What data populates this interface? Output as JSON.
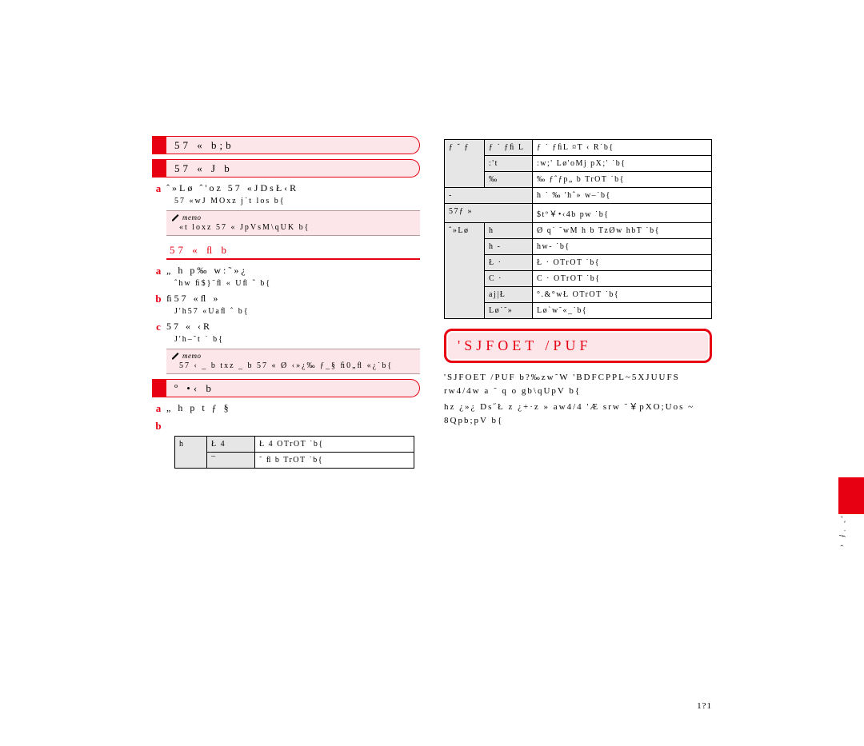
{
  "left": {
    "tab1": "57 «  b;b",
    "tab2": "57 « J b",
    "step_a": {
      "num": "a",
      "txt": "ˆ»Lø ˆ'oz 57 «JDsŁ‹R",
      "desc": "57 «wJ MOxz j˙t los b{"
    },
    "memo1": {
      "label": "memo",
      "body": "«t loxz 57 « JpVsM\\qUK b{"
    },
    "sub1": "57 « ﬂ b",
    "step_b": {
      "num": "a",
      "txt": "„ h p‰  w:˜»¿",
      "desc": "ˆhw ﬁ$}˜ﬂ  « Uﬂ ˆ b{"
    },
    "step_c": {
      "num": "b",
      "txt": "ﬁ57 «ﬂ »",
      "desc": "J'h57 «Uaﬂ ˆ b{"
    },
    "step_d": {
      "num": "c",
      "txt": "57 « ‹R",
      "desc": "J'h–˜t ˙ b{"
    },
    "memo2": {
      "label": "memo",
      "body": "57 ‹ _ b txz _ b 57 « Ø ‹»¿‰ ƒ_§ ﬁ0„ﬂ  «¿˙b{"
    },
    "tab3": "º •‹ b",
    "step_e": {
      "num": "a",
      "txt": "„ h p t  ƒ §"
    },
    "step_f": {
      "num": "b",
      "txt": ""
    },
    "left_table": {
      "rows": [
        [
          "h",
          "Ł 4",
          "Ł 4 OTrOT ˙b{"
        ],
        [
          "",
          "¯",
          "˜ ﬂ b TrOT ˙b{"
        ]
      ]
    }
  },
  "right": {
    "table": {
      "rows": [
        [
          "ƒ ˘ ƒ",
          "ƒ ˙ ƒﬁ L",
          "ƒ ˙ ƒﬁL ¤T ‹ R˙b{"
        ],
        [
          "",
          ":'t",
          ":w;' Lø'oMj pX;' ˙b{"
        ],
        [
          "",
          "‰",
          "‰ ƒˆƒp„ b TrOT ˙b{"
        ],
        [
          "-",
          "",
          "h ˙ ‰ 'hˆ» w–˙b{"
        ],
        [
          "57ƒ »",
          "",
          "$tº￥•‹4b pw ˙b{"
        ],
        [
          "ˆ»Lø",
          "h",
          "Ø q˙ ˜wM h b TzØw hbT ˙b{"
        ],
        [
          "",
          "h -",
          "hw- ˙b{"
        ],
        [
          "",
          "Ł ·",
          "Ł · OTrOT ˙b{"
        ],
        [
          "",
          "C ·",
          "C · OTrOT ˙b{"
        ],
        [
          "",
          "aj|Ł",
          "°.&°wŁ OTrOT ˙b{"
        ],
        [
          "",
          "Lø˙˜»",
          "Lø`w˜«_˙b{"
        ]
      ]
    },
    "big_title": "'SJFOET /PUF",
    "para1": "'SJFOET /PUF b?‰zw˜W 'BDFCPPL~5XJUUFS rw4/4w a ˜ q o gb\\qUpV b{",
    "para2": "hz ¿»¿ Ds˝Ł z ¿+·z » aw4/4 'Æ srw ˜￥pXO;Uos ~ 8Qpb;pV b{"
  },
  "page_number": "1?1",
  "vertical": "-˜ ˙ƒ ‹"
}
